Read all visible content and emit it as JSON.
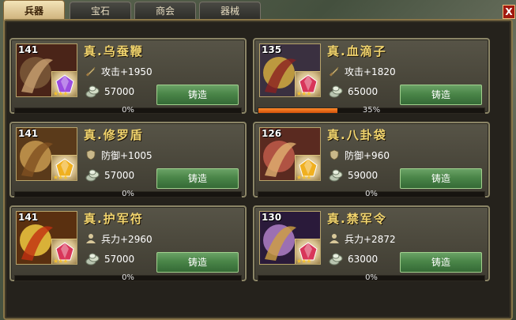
{
  "tabs": [
    {
      "label": "兵器",
      "active": true
    },
    {
      "label": "宝石",
      "active": false
    },
    {
      "label": "商会",
      "active": false
    },
    {
      "label": "器械",
      "active": false
    }
  ],
  "close_label": "X",
  "forge_label": "铸造",
  "items": [
    {
      "name": "真.乌蚕鞭",
      "level": "141",
      "stat_type": "sword-icon",
      "stat": "攻击+1950",
      "cost": "57000",
      "progress": 0,
      "progress_label": "0%",
      "gem_color": "#9b4de0",
      "stars": "★★★"
    },
    {
      "name": "真.血滴子",
      "level": "135",
      "stat_type": "sword-icon",
      "stat": "攻击+1820",
      "cost": "65000",
      "progress": 0.35,
      "progress_label": "35%",
      "gem_color": "#d8365a",
      "stars": "★★★"
    },
    {
      "name": "真.修罗盾",
      "level": "141",
      "stat_type": "shield-icon",
      "stat": "防御+1005",
      "cost": "57000",
      "progress": 0,
      "progress_label": "0%",
      "gem_color": "#f0b020",
      "stars": "★★★"
    },
    {
      "name": "真.八卦袋",
      "level": "126",
      "stat_type": "shield-icon",
      "stat": "防御+960",
      "cost": "59000",
      "progress": 0,
      "progress_label": "0%",
      "gem_color": "#f0b020",
      "stars": "★★★"
    },
    {
      "name": "真.护军符",
      "level": "141",
      "stat_type": "person-icon",
      "stat": "兵力+2960",
      "cost": "57000",
      "progress": 0,
      "progress_label": "0%",
      "gem_color": "#d8365a",
      "stars": "★★★"
    },
    {
      "name": "真.禁军令",
      "level": "130",
      "stat_type": "person-icon",
      "stat": "兵力+2872",
      "cost": "63000",
      "progress": 0,
      "progress_label": "0%",
      "gem_color": "#d8365a",
      "stars": "★★★"
    }
  ],
  "colors": {
    "progress_fill": "#e8701a",
    "name": "#f2d56e",
    "button": "#4a8548"
  }
}
